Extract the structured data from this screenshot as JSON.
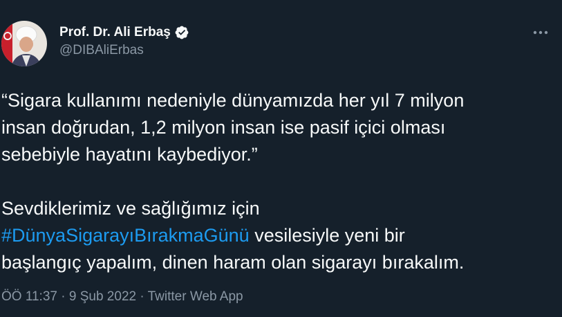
{
  "author": {
    "display_name": "Prof. Dr. Ali Erbaş",
    "handle": "@DIBAliErbas",
    "verified": true
  },
  "icons": {
    "verified": "verified-badge-icon",
    "more": "more-options-icon",
    "avatar": "profile-photo"
  },
  "tweet": {
    "line1": "“Sigara kullanımı nedeniyle dünyamızda her yıl 7 milyon",
    "line2": "insan doğrudan, 1,2 milyon insan ise pasif içici olması",
    "line3": "sebebiyle hayatını kaybediyor.”",
    "line4": "Sevdiklerimiz ve sağlığımız için",
    "hashtag": "#DünyaSigarayıBırakmaGünü",
    "line5_rest": " vesilesiyle yeni bir",
    "line6": "başlangıç yapalım, dinen haram olan sigarayı bırakalım."
  },
  "meta": {
    "time": "ÖÖ 11:37",
    "separator": "·",
    "date": "9 Şub 2022",
    "source": "Twitter Web App"
  },
  "colors": {
    "background": "#15202b",
    "text": "#f7f9f9",
    "secondary": "#8b98a5",
    "link": "#1d9bf0"
  }
}
